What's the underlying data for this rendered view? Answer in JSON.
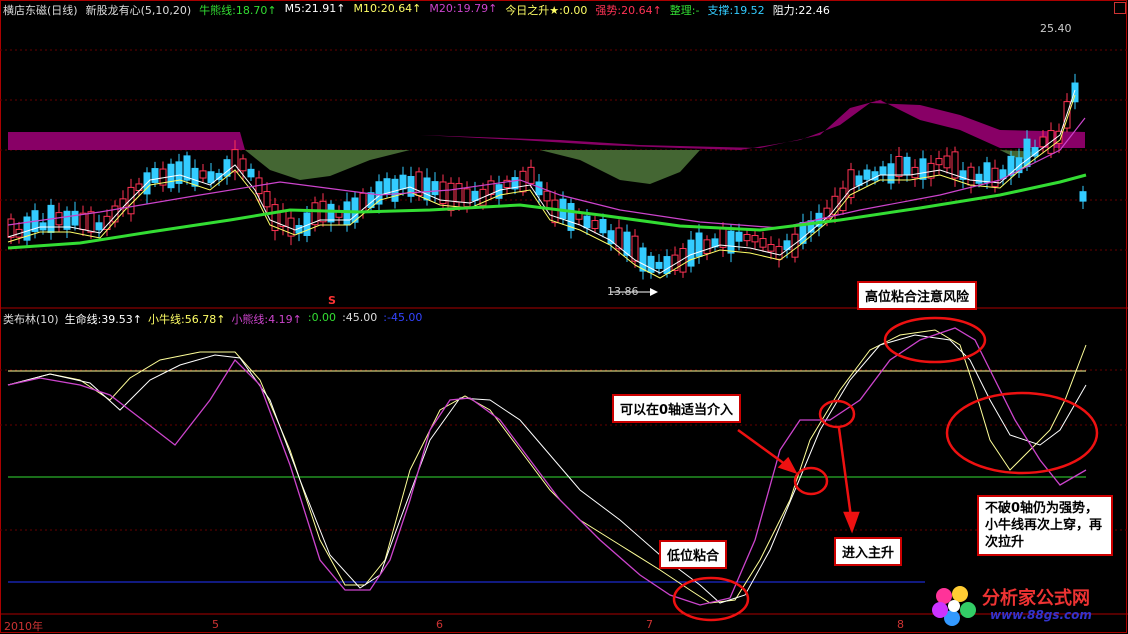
{
  "main_header": {
    "title": "横店东磁(日线)",
    "indicator": "新股龙有心(5,10,20)",
    "niu": "牛熊线:18.70↑",
    "m5": "M5:21.91↑",
    "m10": "M10:20.64↑",
    "m20": "M20:19.79↑",
    "today": "今日之升★:0.00",
    "strong": "强势:20.64↑",
    "consol": "整理:-",
    "support": "支撑:19.52",
    "resist": "阻力:22.46"
  },
  "sub_header": {
    "name": "类布林(10)",
    "life": "生命线:39.53↑",
    "small_bull": "小牛线:56.78↑",
    "small_bear": "小熊线:4.19↑",
    "zero": ":0.00",
    "p45": ":45.00",
    "m45": ":-45.00"
  },
  "price_labels": {
    "high": "25.40",
    "low": "13.86",
    "s_mark": "S"
  },
  "date_axis": [
    "2010年",
    "5",
    "6",
    "7",
    "8"
  ],
  "annotations": {
    "high_risk": "高位粘合注意风险",
    "zero_entry": "可以在0轴适当介入",
    "low_stick": "低位粘合",
    "main_rise": "进入主升",
    "no_break": "不破0轴仍为强势，小牛线再次上穿，再次拉升"
  },
  "watermark": {
    "cn": "分析家公式网",
    "url": "www.88gs.com"
  },
  "colors": {
    "background": "#000000",
    "up_candle": "#ff3355",
    "down_candle": "#33ccff",
    "green_line": "#33dd33",
    "purple_line": "#cc44cc",
    "white_line": "#ffffff",
    "yellow_line": "#ffff66",
    "cloud_purple": "#880066",
    "cloud_green": "#446633",
    "annotation_red": "#ee1111"
  }
}
